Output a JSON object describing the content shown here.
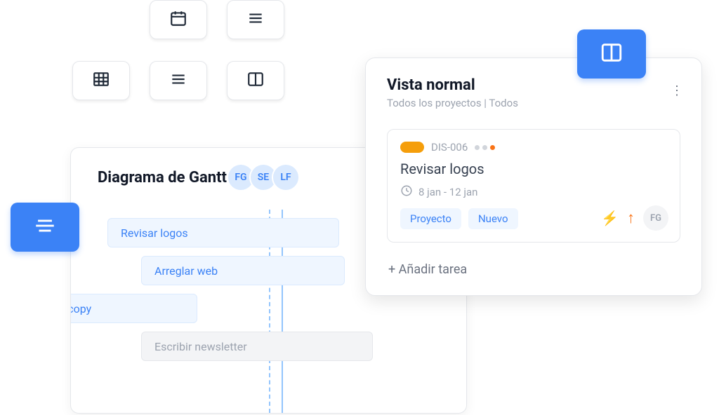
{
  "viewButtons": {
    "calendar": "calendar-icon",
    "list1": "list-icon",
    "table": "table-icon",
    "list2": "list-icon",
    "columns": "columns-icon"
  },
  "gantt": {
    "title": "Diagrama de Gantt",
    "avatars": [
      "FG",
      "SE",
      "LF"
    ],
    "bars": [
      {
        "label": "Revisar logos"
      },
      {
        "label": "Arreglar web"
      },
      {
        "label": "Revisar copy"
      },
      {
        "label": "Escribir newsletter"
      }
    ]
  },
  "card": {
    "title": "Vista normal",
    "subtitle": "Todos los proyectos  |  Todos",
    "task": {
      "id": "DIS-006",
      "name": "Revisar logos",
      "dateRange": "8 jan - 12 jan",
      "tags": [
        "Proyecto",
        "Nuevo"
      ],
      "assignee": "FG"
    },
    "addTask": "+ Añadir tarea"
  }
}
